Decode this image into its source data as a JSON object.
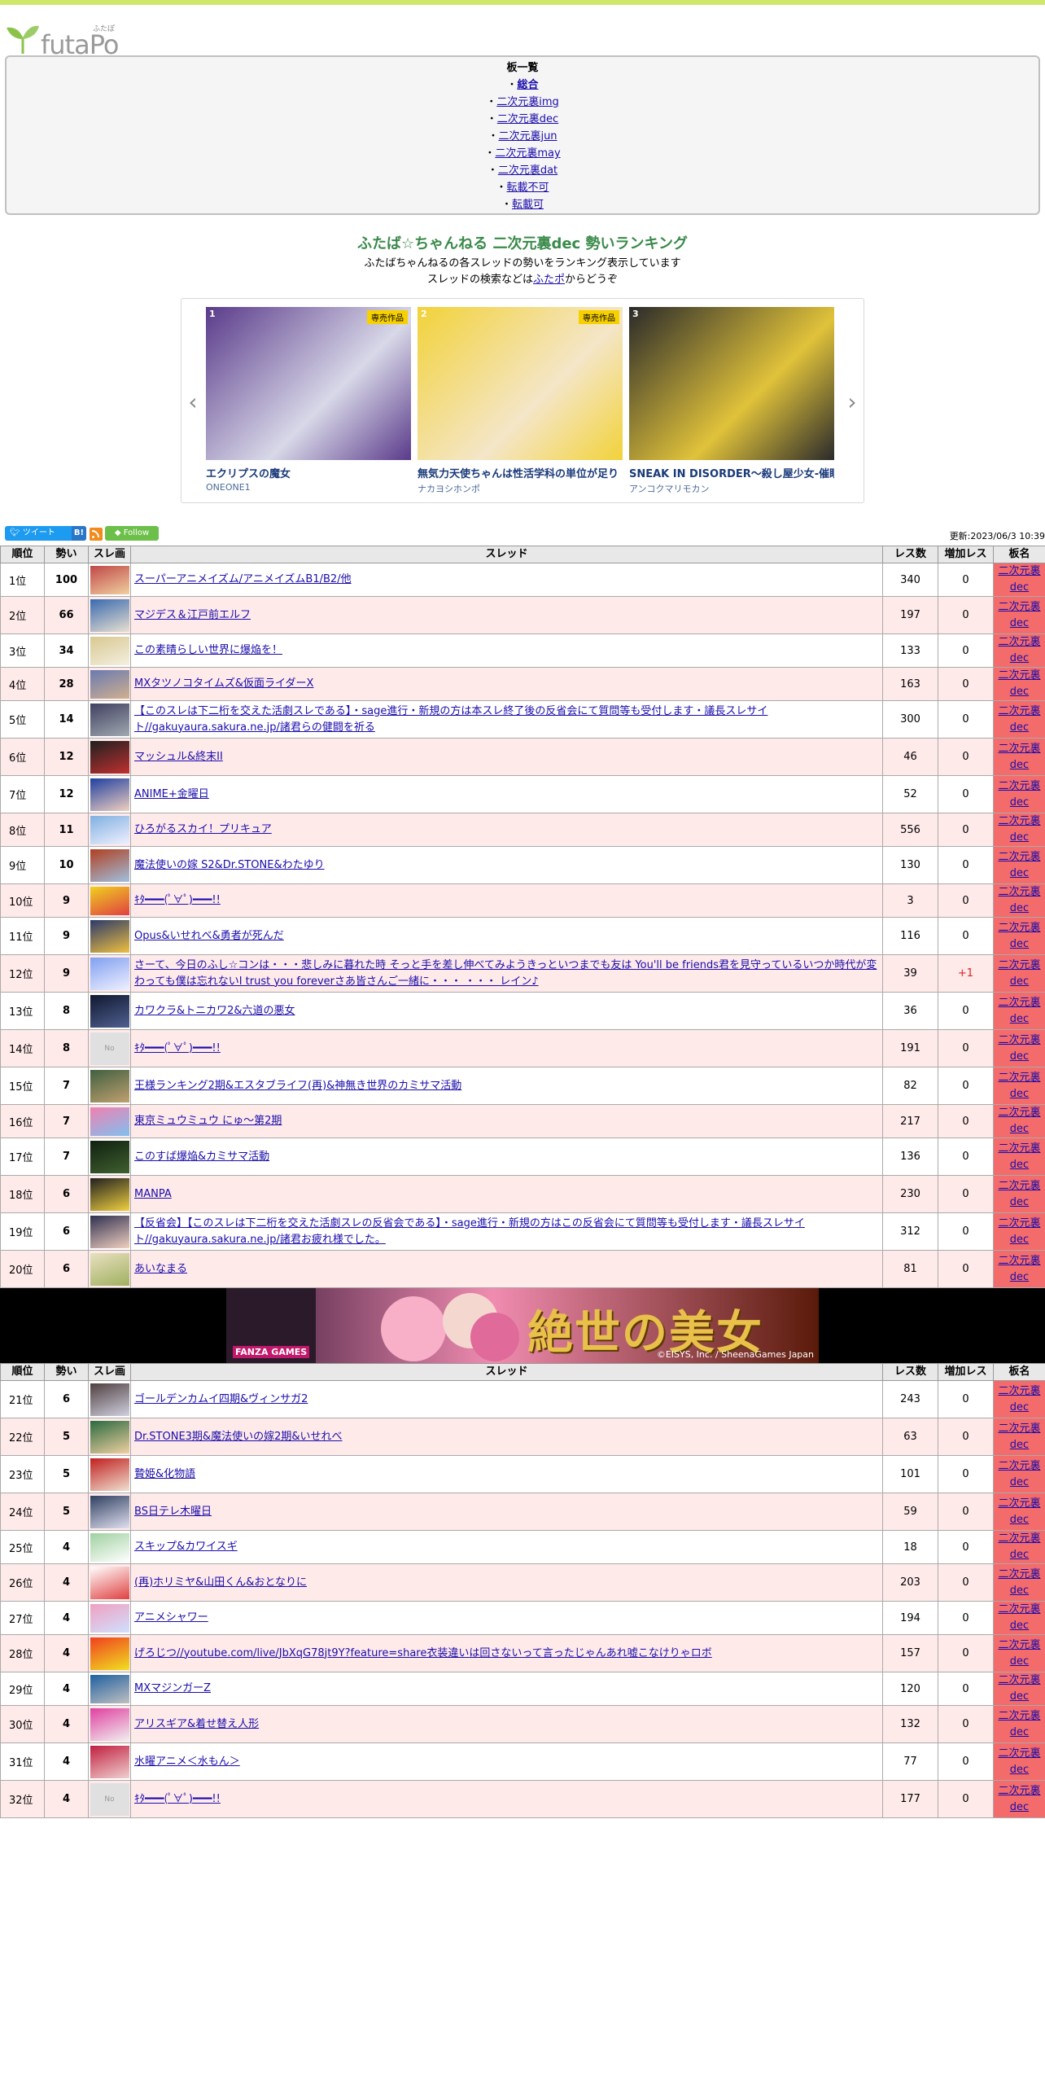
{
  "site": {
    "logo_text": "futaPo",
    "logo_kana": "ふたぽ"
  },
  "board_list": {
    "title": "板一覧",
    "items": [
      {
        "label": "総合",
        "current": true
      },
      {
        "label": "二次元裏img"
      },
      {
        "label": "二次元裏dec"
      },
      {
        "label": "二次元裏jun"
      },
      {
        "label": "二次元裏may"
      },
      {
        "label": "二次元裏dat"
      },
      {
        "label": "転載不可"
      },
      {
        "label": "転載可"
      }
    ]
  },
  "page": {
    "title": "ふたば☆ちゃんねる 二次元裏dec 勢いランキング",
    "desc1": "ふたばちゃんねるの各スレッドの勢いをランキング表示しています",
    "desc2_pre": "スレッドの検索などは",
    "desc2_link": "ふたポ",
    "desc2_post": "からどうぞ"
  },
  "carousel": {
    "prev_icon": "chevron-left-icon",
    "next_icon": "chevron-right-icon",
    "cards": [
      {
        "num": "1",
        "badge": "専売作品",
        "title": "エクリプスの魔女",
        "circle": "ONEONE1",
        "color1": "#5a3a8a",
        "color2": "#d8d8e8"
      },
      {
        "num": "2",
        "badge": "専売作品",
        "title": "無気力天使ちゃんは性活学科の単位が足り",
        "circle": "ナカヨシホンポ",
        "color1": "#f2d23a",
        "color2": "#f4e6c8"
      },
      {
        "num": "3",
        "badge": "",
        "title": "SNEAK IN DISORDER～殺し屋少女-催眠",
        "circle": "アンコクマリモカン",
        "color1": "#2a2a2a",
        "color2": "#e0c23a"
      }
    ]
  },
  "share": {
    "tweet": "ツイート",
    "hatena": "B!",
    "follow": "Follow",
    "rss_icon": "rss-icon"
  },
  "updated": "更新:2023/06/3 10:39",
  "table": {
    "headers": [
      "順位",
      "勢い",
      "スレ画",
      "スレッド",
      "レス数",
      "増加レス",
      "板名"
    ],
    "board_name": "二次元裏dec"
  },
  "rows1": [
    {
      "rank": "1位",
      "mom": "100",
      "title": "スーパーアニメイズム/アニメイズムB1/B2/他",
      "res": "340",
      "inc": "0"
    },
    {
      "rank": "2位",
      "mom": "66",
      "title": "マジデス＆江戸前エルフ",
      "res": "197",
      "inc": "0"
    },
    {
      "rank": "3位",
      "mom": "34",
      "title": "この素晴らしい世界に爆焔を！",
      "res": "133",
      "inc": "0"
    },
    {
      "rank": "4位",
      "mom": "28",
      "title": "MXタツノコタイムズ&仮面ライダーX",
      "res": "163",
      "inc": "0"
    },
    {
      "rank": "5位",
      "mom": "14",
      "title": "【このスレは下二桁を交えた活劇スレである】・sage進行・新規の方は本スレ終了後の反省会にて質問等も受付します・議長スレサイト//gakuyaura.sakura.ne.jp/諸君らの健闘を祈る",
      "res": "300",
      "inc": "0"
    },
    {
      "rank": "6位",
      "mom": "12",
      "title": "マッシュル&終末II",
      "res": "46",
      "inc": "0"
    },
    {
      "rank": "7位",
      "mom": "12",
      "title": "ANIME+金曜日",
      "res": "52",
      "inc": "0"
    },
    {
      "rank": "8位",
      "mom": "11",
      "title": "ひろがるスカイ！プリキュア",
      "res": "556",
      "inc": "0"
    },
    {
      "rank": "9位",
      "mom": "10",
      "title": "魔法使いの嫁 S2&Dr.STONE&わたゆり",
      "res": "130",
      "inc": "0"
    },
    {
      "rank": "10位",
      "mom": "9",
      "title": "ｷﾀ━━━(ﾟ∀ﾟ)━━━!!",
      "res": "3",
      "inc": "0"
    },
    {
      "rank": "11位",
      "mom": "9",
      "title": "Opus&いせれべ&勇者が死んだ",
      "res": "116",
      "inc": "0"
    },
    {
      "rank": "12位",
      "mom": "9",
      "title": "さーて、今日のふし☆コンは・・・悲しみに暮れた時 そっと手を差し伸べてみようきっといつまでも友は You'll be friends君を見守っているいつか時代が変わっても僕は忘れないI trust you foreverさあ皆さんご一緒に・・・ ・・・ レイン♪",
      "res": "39",
      "inc": "+1"
    },
    {
      "rank": "13位",
      "mom": "8",
      "title": "カワクラ&トニカワ2&六道の悪女",
      "res": "36",
      "inc": "0"
    },
    {
      "rank": "14位",
      "mom": "8",
      "title": "ｷﾀ━━━(ﾟ∀ﾟ)━━━!!",
      "res": "191",
      "inc": "0",
      "nothumb": true
    },
    {
      "rank": "15位",
      "mom": "7",
      "title": "王様ランキング2期&エスタブライフ(再)&神無き世界のカミサマ活動",
      "res": "82",
      "inc": "0"
    },
    {
      "rank": "16位",
      "mom": "7",
      "title": "東京ミュウミュウ にゅ～第2期",
      "res": "217",
      "inc": "0"
    },
    {
      "rank": "17位",
      "mom": "7",
      "title": "このすば爆焔&カミサマ活動",
      "res": "136",
      "inc": "0"
    },
    {
      "rank": "18位",
      "mom": "6",
      "title": "MANPA",
      "res": "230",
      "inc": "0"
    },
    {
      "rank": "19位",
      "mom": "6",
      "title": "【反省会】【このスレは下二桁を交えた活劇スレの反省会である】・sage進行・新規の方はこの反省会にて質問等も受付します・議長スレサイト//gakuyaura.sakura.ne.jp/諸君お疲れ様でした。",
      "res": "312",
      "inc": "0"
    },
    {
      "rank": "20位",
      "mom": "6",
      "title": "あいなまる",
      "res": "81",
      "inc": "0"
    }
  ],
  "ad": {
    "maker": "FANZA GAMES",
    "catch": "絶世の美女が…",
    "copy": "©EISYS, Inc. / SheenaGames Japan"
  },
  "rows2": [
    {
      "rank": "21位",
      "mom": "6",
      "title": "ゴールデンカムイ四期&ヴィンサガ2",
      "res": "243",
      "inc": "0"
    },
    {
      "rank": "22位",
      "mom": "5",
      "title": "Dr.STONE3期&魔法使いの嫁2期&いせれべ",
      "res": "63",
      "inc": "0"
    },
    {
      "rank": "23位",
      "mom": "5",
      "title": "贄姫&化物語",
      "res": "101",
      "inc": "0"
    },
    {
      "rank": "24位",
      "mom": "5",
      "title": "BS日テレ木曜日",
      "res": "59",
      "inc": "0"
    },
    {
      "rank": "25位",
      "mom": "4",
      "title": "スキップ&カワイスギ",
      "res": "18",
      "inc": "0"
    },
    {
      "rank": "26位",
      "mom": "4",
      "title": "(再)ホリミヤ&山田くん&おとなりに",
      "res": "203",
      "inc": "0"
    },
    {
      "rank": "27位",
      "mom": "4",
      "title": "アニメシャワー",
      "res": "194",
      "inc": "0"
    },
    {
      "rank": "28位",
      "mom": "4",
      "title": "げろじつ//youtube.com/live/JbXqG78jt9Y?feature=share衣装違いは回さないって言ったじゃんあれ嘘こなけりゃロボ",
      "res": "157",
      "inc": "0"
    },
    {
      "rank": "29位",
      "mom": "4",
      "title": "MXマジンガーZ",
      "res": "120",
      "inc": "0"
    },
    {
      "rank": "30位",
      "mom": "4",
      "title": "アリスギア&着せ替え人形",
      "res": "132",
      "inc": "0"
    },
    {
      "rank": "31位",
      "mom": "4",
      "title": "水曜アニメ＜水もん＞",
      "res": "77",
      "inc": "0"
    },
    {
      "rank": "32位",
      "mom": "4",
      "title": "ｷﾀ━━━(ﾟ∀ﾟ)━━━!!",
      "res": "177",
      "inc": "0",
      "nothumb": true
    }
  ]
}
